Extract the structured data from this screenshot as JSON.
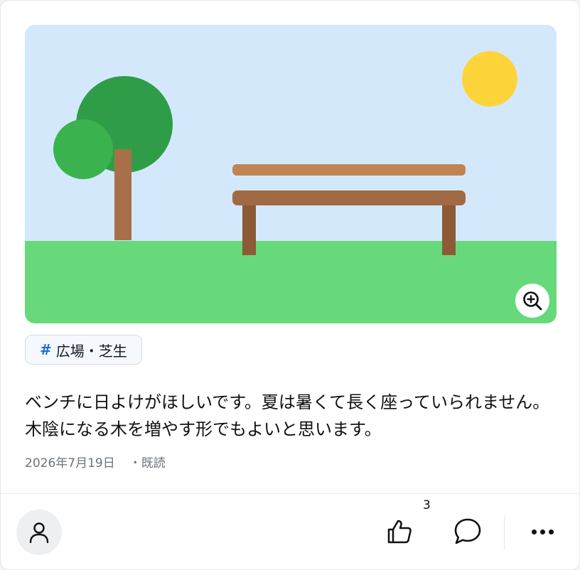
{
  "post": {
    "tag": {
      "hash": "#",
      "label": "広場・芝生"
    },
    "text": "ベンチに日よけがほしいです。夏は暑くて長く座っていられません。木陰になる木を増やす形でもよいと思います。",
    "date": "2026年7月19日",
    "status": "・既読"
  },
  "actions": {
    "like_count": "3"
  },
  "icons": {
    "zoom": "zoom-in-icon",
    "user": "user-icon",
    "like": "thumbs-up-icon",
    "comment": "comment-icon",
    "more": "more-horizontal-icon"
  },
  "colors": {
    "sky": "#d3e9fb",
    "grass": "#68d97b",
    "sun": "#fdd43a",
    "tree_dark": "#2f9d48",
    "tree_light": "#3ab24e",
    "trunk": "#a8704a",
    "bench_seat": "#a06a44",
    "bench_back": "#be8552",
    "bench_legs": "#8d5a36",
    "tag_hash": "#1e6fc4"
  }
}
